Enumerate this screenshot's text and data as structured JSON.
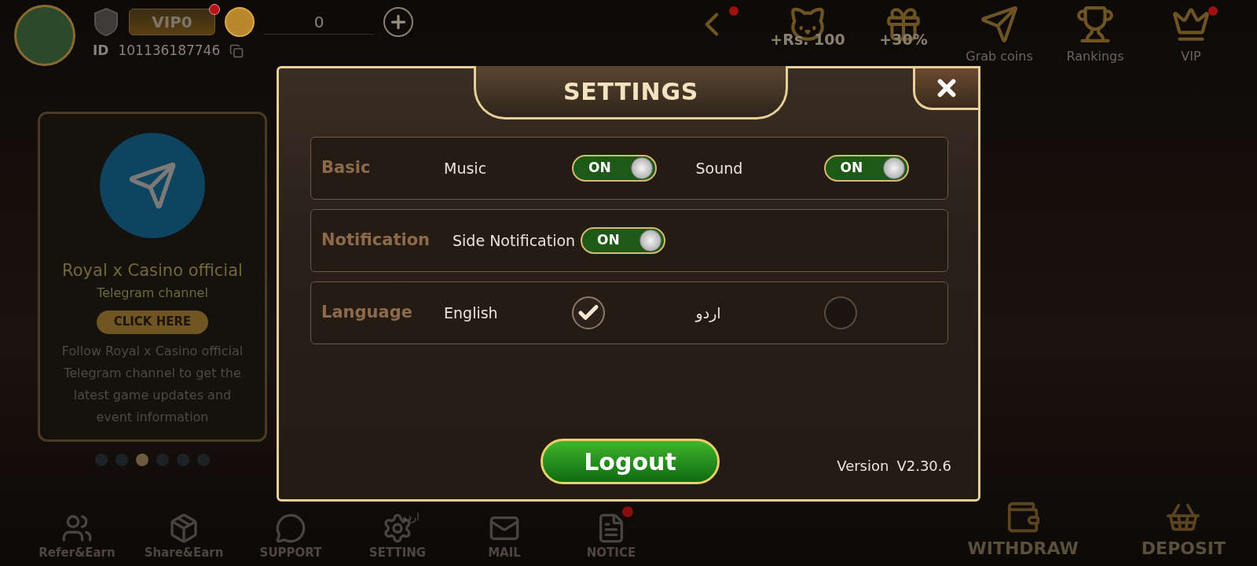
{
  "header": {
    "vip_label": "VIP0",
    "vip_badge": true,
    "balance": "0",
    "id_label": "ID",
    "user_id": "101136187746"
  },
  "top_icons": [
    {
      "kind": "back",
      "badge": true
    },
    {
      "kind": "cash",
      "overlay": "+Rs. 100",
      "badge": false
    },
    {
      "kind": "deposit",
      "overlay": "+30%",
      "badge": false
    },
    {
      "kind": "grab",
      "label": "Grab coins",
      "badge": false
    },
    {
      "kind": "rank",
      "label": "Rankings",
      "badge": false
    },
    {
      "kind": "vip",
      "label": "VIP",
      "badge": true
    }
  ],
  "banner": {
    "title": "Royal x Casino official",
    "subtitle": "Telegram channel",
    "button": "CLICK HERE",
    "description": "Follow Royal x Casino official Telegram channel to get the latest game updates and event information",
    "dots": [
      {
        "selected": false
      },
      {
        "selected": false
      },
      {
        "selected": true
      },
      {
        "selected": false
      },
      {
        "selected": false
      },
      {
        "selected": false
      }
    ]
  },
  "dialog": {
    "title": "SETTINGS",
    "sections": [
      {
        "label": "Basic",
        "items": [
          {
            "kind": "toggle",
            "label": "Music",
            "on": true,
            "state_text": "ON"
          },
          {
            "kind": "toggle",
            "label": "Sound",
            "on": true,
            "state_text": "ON"
          }
        ]
      },
      {
        "label": "Notification",
        "items": [
          {
            "kind": "toggle",
            "label": "Side Notification",
            "on": true,
            "state_text": "ON"
          }
        ]
      },
      {
        "label": "Language",
        "items": [
          {
            "kind": "radio",
            "label": "English",
            "selected": true
          },
          {
            "kind": "radio",
            "label": "اردو",
            "selected": false
          }
        ]
      }
    ],
    "logout": "Logout",
    "version_label": "Version",
    "version": "V2.30.6"
  },
  "bottom_nav": [
    {
      "kind": "refer",
      "label": "Refer&Earn",
      "badge": false
    },
    {
      "kind": "share",
      "label": "Share&Earn",
      "badge": false
    },
    {
      "kind": "support",
      "label": "SUPPORT",
      "badge": false
    },
    {
      "kind": "setting",
      "label": "SETTING",
      "icon_text": "اردو",
      "badge": false
    },
    {
      "kind": "mail",
      "label": "MAIL",
      "badge": false
    },
    {
      "kind": "notice",
      "label": "NOTICE",
      "badge": true
    }
  ],
  "actions": [
    {
      "kind": "withdraw",
      "label": "WITHDRAW"
    },
    {
      "kind": "deposit",
      "label": "DEPOSIT"
    }
  ]
}
